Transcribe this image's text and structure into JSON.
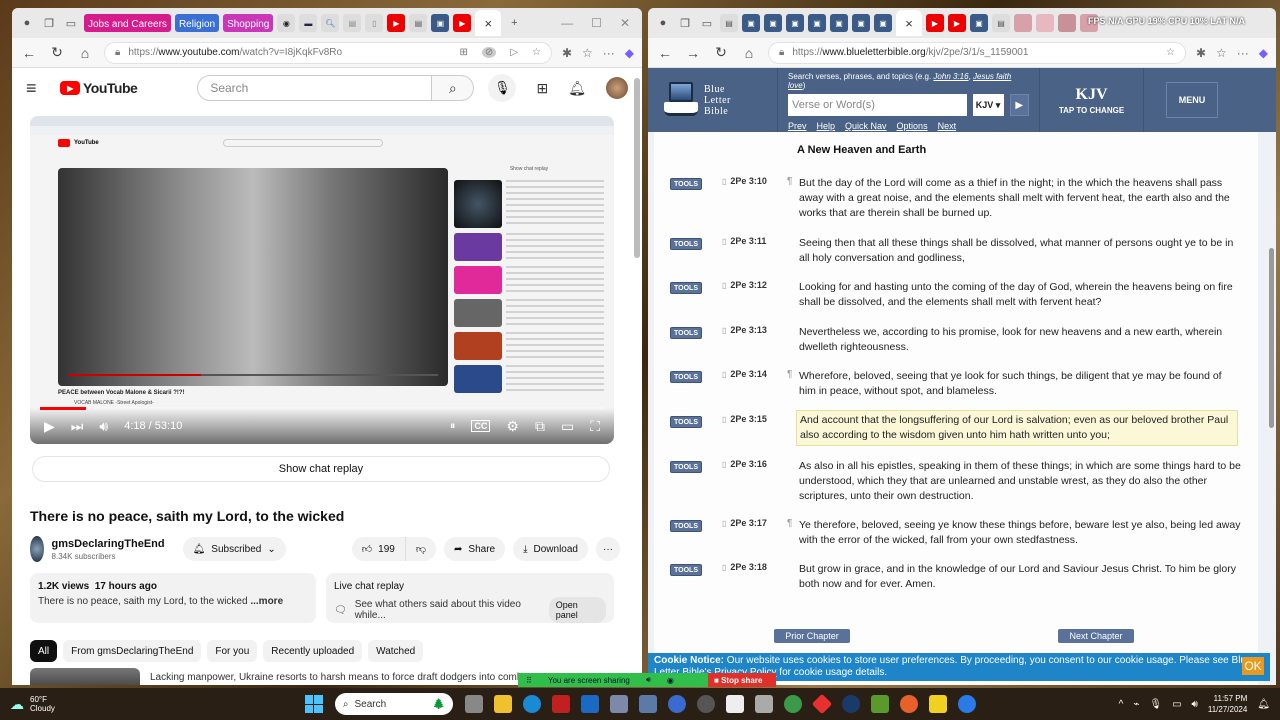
{
  "left_browser": {
    "tab_groups": [
      {
        "label": "Jobs and Careers",
        "color": "#d81b8c"
      },
      {
        "label": "Religion",
        "color": "#3b6fd4"
      },
      {
        "label": "Shopping",
        "color": "#c936b8"
      }
    ],
    "url_prefix": "https://",
    "url_domain": "www.youtube.com",
    "url_path": "/watch?v=I8jKqkFv8Ro"
  },
  "youtube": {
    "search_placeholder": "Search",
    "player": {
      "time_current": "4:18",
      "time_total": "53:10",
      "time_display": "4:18 / 53:10",
      "progress_fraction": 0.081,
      "embedded_title": "PEACE between Vocab Malone & Sicarii ?!?!",
      "embedded_channel": "VOCAB MALONE -Street Apologist-"
    },
    "show_chat_replay": "Show chat replay",
    "video_title": "There is no peace, saith my Lord, to the wicked",
    "channel_name": "gmsDeclaringTheEnd",
    "subscribers": "8.34K subscribers",
    "subscribed_label": "Subscribed",
    "likes": "199",
    "share_label": "Share",
    "download_label": "Download",
    "views": "1.2K views",
    "posted": "17 hours ago",
    "description": "There is no peace, saith my Lord, to the wicked",
    "more_label": "...more",
    "live_chat_title": "Live chat replay",
    "live_chat_desc": "See what others said about this video while...",
    "open_panel": "Open panel",
    "chips": [
      "All",
      "From gmsDeclaringTheEnd",
      "For you",
      "Recently uploaded",
      "Watched"
    ],
    "next_rec_title": "Lacking manpower, Ukraine resorts to harsh means to force draft dodgers into combat"
  },
  "right_browser": {
    "url_prefix": "https://",
    "url_domain": "www.blueletterbible.org",
    "url_path": "/kjv/2pe/3/1/s_1159001",
    "hud": "FPS N/A GPU 19% CPU 10% LAT N/A"
  },
  "blb": {
    "logo_lines": [
      "Blue",
      "Letter",
      "Bible"
    ],
    "search_hint": "Search verses, phrases, and topics (e.g.",
    "search_hint_ex1": "John 3:16",
    "search_hint_ex2": "Jesus faith love",
    "search_placeholder": "Verse or Word(s)",
    "version_select": "KJV",
    "nav_links": [
      "Prev",
      "Help",
      "Quick Nav",
      "Options",
      "Next"
    ],
    "version_big": "KJV",
    "version_tap": "TAP TO CHANGE",
    "menu_label": "MENU",
    "section_heading": "A New Heaven and Earth",
    "tools_label": "TOOLS",
    "verses": [
      {
        "ref": "2Pe 3:10",
        "para": true,
        "text": "But the day of the Lord will come as a thief in the night; in the which the heavens shall pass away with a great noise, and the elements shall melt with fervent heat, the earth also and the works that are therein shall be burned up.",
        "highlighted": false
      },
      {
        "ref": "2Pe 3:11",
        "para": false,
        "text": "Seeing then that all these things shall be dissolved, what manner of persons ought ye to be in all holy conversation and godliness,",
        "highlighted": false
      },
      {
        "ref": "2Pe 3:12",
        "para": false,
        "text": "Looking for and hasting unto the coming of the day of God, wherein the heavens being on fire shall be dissolved, and the elements shall melt with fervent heat?",
        "highlighted": false
      },
      {
        "ref": "2Pe 3:13",
        "para": false,
        "text": "Nevertheless we, according to his promise, look for new heavens and a new earth, wherein dwelleth righteousness.",
        "highlighted": false
      },
      {
        "ref": "2Pe 3:14",
        "para": true,
        "text": "Wherefore, beloved, seeing that ye look for such things, be diligent that ye may be found of him in peace, without spot, and blameless.",
        "highlighted": false
      },
      {
        "ref": "2Pe 3:15",
        "para": false,
        "text": "And account that the longsuffering of our Lord is salvation; even as our beloved brother Paul also according to the wisdom given unto him hath written unto you;",
        "highlighted": true
      },
      {
        "ref": "2Pe 3:16",
        "para": false,
        "text": "As also in all his epistles, speaking in them of these things; in which are some things hard to be understood, which they that are unlearned and unstable wrest, as they do also the other scriptures, unto their own destruction.",
        "highlighted": false
      },
      {
        "ref": "2Pe 3:17",
        "para": true,
        "text": "Ye therefore, beloved, seeing ye know these things before, beware lest ye also, being led away with the error of the wicked, fall from your own stedfastness.",
        "highlighted": false
      },
      {
        "ref": "2Pe 3:18",
        "para": false,
        "text": "But grow in grace, and in the knowledge of our Lord and Saviour Jesus Christ. To him be glory both now and for ever. Amen.",
        "highlighted": false
      }
    ],
    "prior_chapter": "Prior Chapter",
    "next_chapter": "Next Chapter",
    "cookie_bold": "Cookie Notice:",
    "cookie_text": " Our website uses cookies to store user preferences. By proceeding, you consent to our cookie usage. Please see Blue Letter Bible's ",
    "cookie_link": "Privacy Policy",
    "cookie_tail": " for cookie usage details.",
    "cookie_ok": "OK"
  },
  "screen_share": {
    "status": "You are screen sharing",
    "stop": "Stop share"
  },
  "taskbar": {
    "temp": "60°F",
    "condition": "Cloudy",
    "search_label": "Search",
    "time": "11:57 PM",
    "date": "11/27/2024"
  }
}
